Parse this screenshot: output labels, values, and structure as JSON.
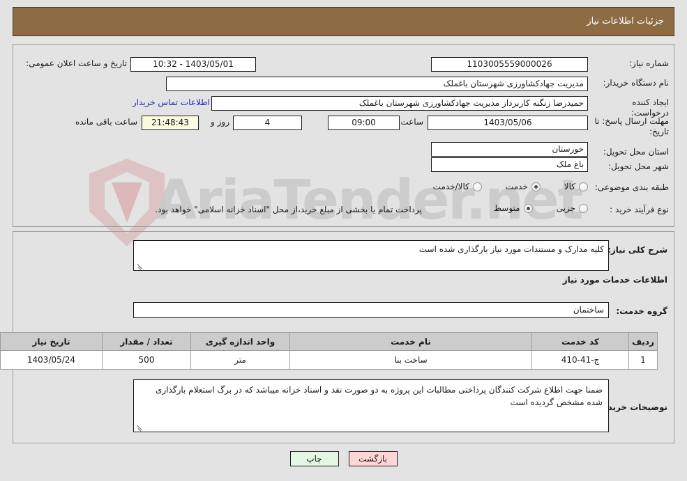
{
  "header": {
    "title": "جزئیات اطلاعات نیاز",
    "bg_color": "#8d6b43",
    "text_color": "#ffffff"
  },
  "watermark": {
    "text": "AriaTender.net",
    "shield_color": "#d9a9ac",
    "text_color": "#c9c9c9"
  },
  "form": {
    "need_number": {
      "label": "شماره نیاز:",
      "value": "1103005559000026"
    },
    "public_announce": {
      "label": "تاریخ و ساعت اعلان عمومی:",
      "value": "1403/05/01 - 10:32"
    },
    "buyer_org": {
      "label": "نام دستگاه خریدار:",
      "value": "مدیریت جهادکشاورزی شهرستان باغملک"
    },
    "creator": {
      "label": "ایجاد کننده درخواست:",
      "value": "حمیدرضا زنگنه کاربرداز مدیریت جهادکشاورزی شهرستان باغملک"
    },
    "contact_link": {
      "label": "اطلاعات تماس خریدار",
      "color": "#2222cc"
    },
    "deadline": {
      "label": "مهلت ارسال پاسخ: تا تاریخ:",
      "date": "1403/05/06",
      "time_label": "ساعت",
      "time": "09:00",
      "days": "4",
      "days_label": "روز و",
      "remaining": "21:48:43",
      "remaining_label": "ساعت باقی مانده",
      "remaining_bg": "#fbfbe0"
    },
    "province": {
      "label": "استان محل تحویل:",
      "value": "خوزستان"
    },
    "city": {
      "label": "شهر محل تحویل:",
      "value": "باغ ملک"
    },
    "category": {
      "label": "طبقه بندی موضوعی:",
      "options": [
        {
          "label": "کالا",
          "checked": false
        },
        {
          "label": "خدمت",
          "checked": true
        },
        {
          "label": "کالا/خدمت",
          "checked": false
        }
      ]
    },
    "process_type": {
      "label": "نوع فرآیند خرید :",
      "options": [
        {
          "label": "جزیی",
          "checked": false
        },
        {
          "label": "متوسط",
          "checked": true
        }
      ],
      "note": "پرداخت تمام یا بخشی از مبلغ خرید،از محل \"اسناد خزانه اسلامی\" خواهد بود."
    }
  },
  "general_description": {
    "label": "شرح کلی نیاز:",
    "value": "کلیه مدارک و مستندات مورد نیاز بارگذاری شده است"
  },
  "services_section": {
    "heading": "اطلاعات خدمات مورد نیاز",
    "service_group": {
      "label": "گروه خدمت:",
      "value": "ساختمان"
    }
  },
  "items_table": {
    "columns": [
      "ردیف",
      "کد خدمت",
      "نام خدمت",
      "واحد اندازه گیری",
      "تعداد / مقدار",
      "تاریخ نیاز"
    ],
    "rows": [
      {
        "row_no": "1",
        "service_code": "ج-41-410",
        "service_name": "ساخت بنا",
        "unit": "متر",
        "quantity": "500",
        "need_date": "1403/05/24"
      }
    ]
  },
  "buyer_notes": {
    "label": "توضیحات خریدار:",
    "value": "ضمنا جهت اطلاع شرکت کنندگان پرداختی مطالبات این پروژه به دو صورت نقد و اسناد خزانه میباشد که در برگ استعلام بارگذاری شده مشخص گردیده است"
  },
  "footer": {
    "print_label": "چاپ",
    "back_label": "بازگشت",
    "print_bg": "#e3f7e3",
    "back_bg": "#ffd6d6"
  }
}
